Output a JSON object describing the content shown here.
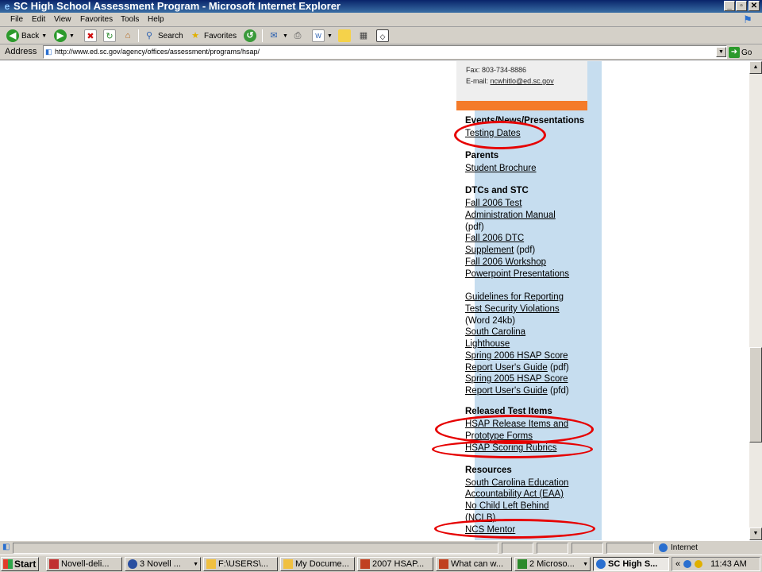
{
  "window": {
    "title": "SC High School Assessment Program - Microsoft Internet Explorer",
    "minimize": "_",
    "maximize": "▫",
    "close": "✕"
  },
  "menu": [
    "File",
    "Edit",
    "View",
    "Favorites",
    "Tools",
    "Help"
  ],
  "toolbar": {
    "back_label": "Back",
    "search_label": "Search",
    "favorites_label": "Favorites"
  },
  "address": {
    "label": "Address",
    "url": "http://www.ed.sc.gov/agency/offices/assessment/programs/hsap/",
    "go_label": "Go"
  },
  "page": {
    "contact": {
      "fax": "Fax: 803-734-8886",
      "email_prefix": "E-mail: ",
      "email": "ncwhitlo@ed.sc.gov"
    },
    "events": {
      "heading": "Events/News/Presentations",
      "testing_dates": "Testing Dates"
    },
    "parents": {
      "heading": "Parents",
      "student_brochure": "Student Brochure"
    },
    "dtcs": {
      "heading": "DTCs and STC",
      "fall_test_l1": "Fall 2006 Test",
      "fall_test_l2": "Administration Manual",
      "pdf1": "(pdf)",
      "fall_dtc_l1": "Fall 2006 DTC",
      "fall_dtc_l2": "Supplement",
      "pdf2": " (pdf)",
      "workshop_l1": "Fall 2006 Workshop",
      "workshop_l2": "Powerpoint Presentations",
      "guidelines_l1": "Guidelines for Reporting",
      "guidelines_l2": "Test Security Violations",
      "word": "(Word 24kb)",
      "lighthouse_l1": "South Carolina",
      "lighthouse_l2": "Lighthouse",
      "spring06_l1": "Spring 2006 HSAP Score",
      "spring06_l2": "Report User's Guide",
      "pdf3": " (pdf)",
      "spring05_l1": "Spring 2005 HSAP Score",
      "spring05_l2": "Report User's Guide",
      "pfd": " (pfd)"
    },
    "released": {
      "heading": "Released Test Items",
      "release_l1": "HSAP Release Items and",
      "release_l2": "Prototype Forms",
      "rubrics": "HSAP Scoring Rubrics"
    },
    "resources": {
      "heading": "Resources",
      "eaa_l1": "South Carolina Education",
      "eaa_l2": "Accountability Act (EAA)",
      "nclb_l1": "No Child Left Behind",
      "nclb_l2": "(NCLB)",
      "ncs": "NCS Mentor"
    }
  },
  "status": {
    "zone": "Internet"
  },
  "taskbar": {
    "start": "Start",
    "tasks": [
      "Novell-deli...",
      "3 Novell ...",
      "F:\\USERS\\...",
      "My Docume...",
      "2007 HSAP...",
      "What can w...",
      "2 Microso...",
      "SC High S..."
    ],
    "tray_chevron": "«",
    "clock": "11:43 AM"
  },
  "colors": {
    "sidebar_blue": "#c6ddef",
    "accent_orange": "#f47b2a",
    "annotation_red": "#e60000"
  }
}
